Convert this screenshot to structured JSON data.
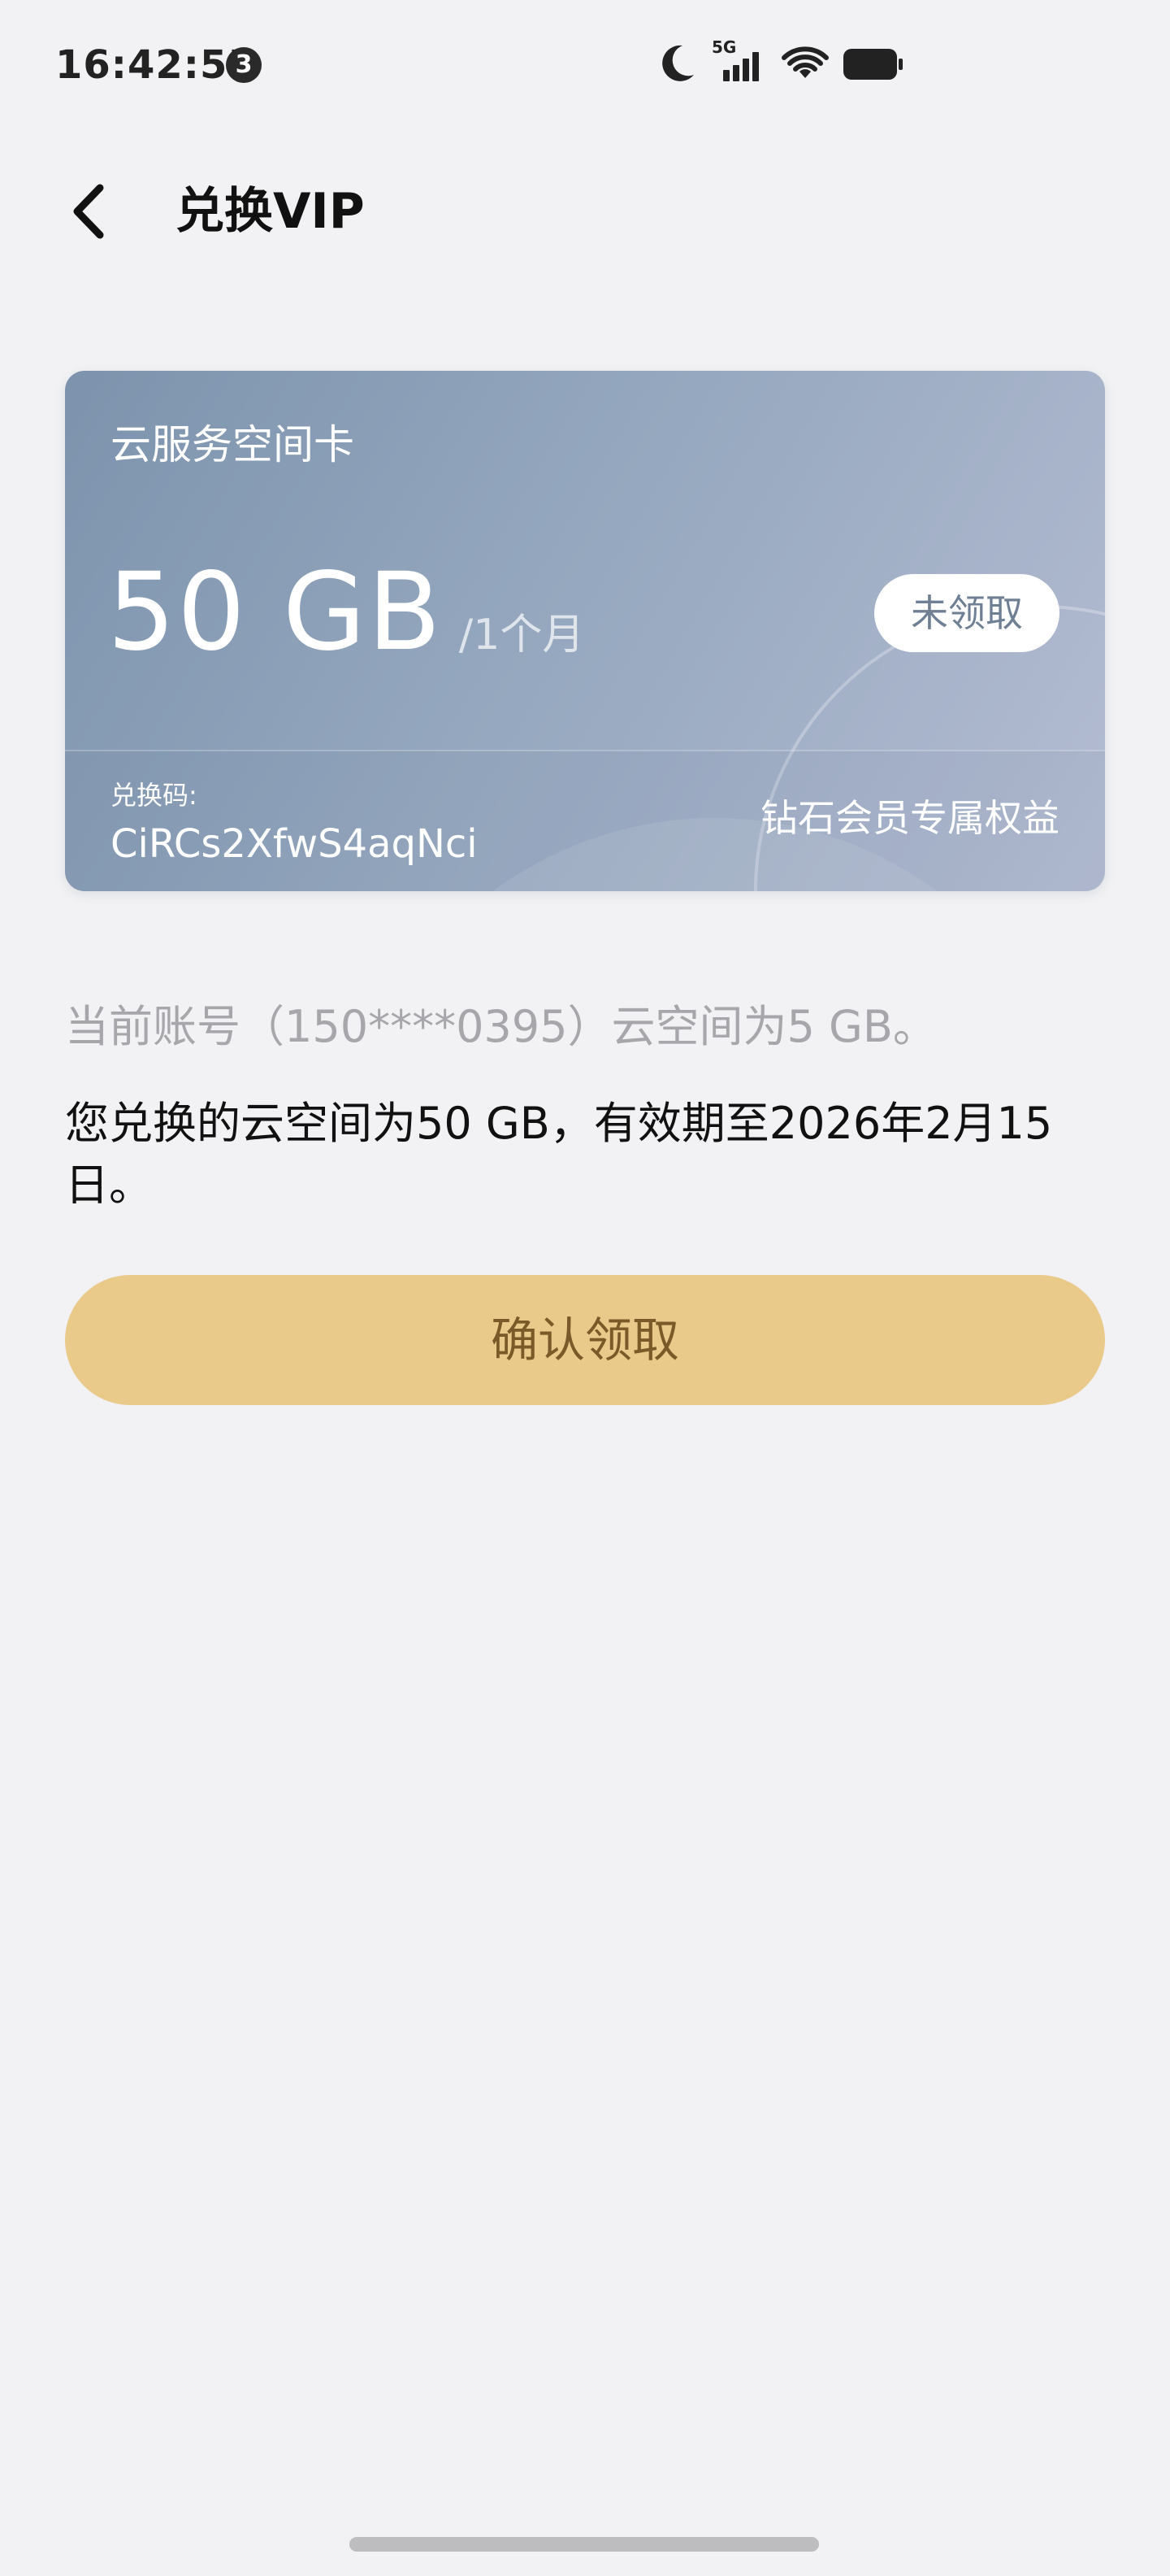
{
  "status_bar": {
    "time": "16:42:55",
    "notification_count": "3",
    "network_label": "5G",
    "icons": [
      "moon-icon",
      "signal-5g-icon",
      "wifi-icon",
      "battery-icon"
    ]
  },
  "header": {
    "title": "兑换VIP",
    "back_icon": "chevron-left-icon"
  },
  "card": {
    "type": "云服务空间卡",
    "amount": "50 GB",
    "period": "/1个月",
    "status": "未领取",
    "code_label": "兑换码:",
    "code": "CiRCs2XfwS4aqNci",
    "benefit": "钻石会员专属权益"
  },
  "info": {
    "current_account": "当前账号（150****0395）云空间为5 GB。",
    "exchange_detail": "您兑换的云空间为50 GB，有效期至2026年2月15日。"
  },
  "actions": {
    "confirm_label": "确认领取"
  },
  "colors": {
    "background": "#f2f2f4",
    "card_gradient_start": "#7d93ad",
    "card_gradient_end": "#b4bcd2",
    "confirm_button": "#eaca8b",
    "confirm_text": "#7a5a28",
    "muted_text": "#a6a6ab"
  }
}
